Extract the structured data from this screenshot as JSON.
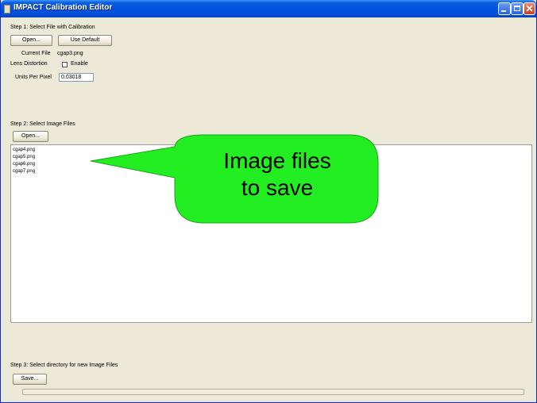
{
  "window": {
    "title": "IMPACT Calibration Editor",
    "controls": [
      "minimize-icon",
      "maximize-icon",
      "close-icon"
    ]
  },
  "step1": {
    "heading": "Step 1: Select File with Calibration",
    "open_label": "Open...",
    "use_default_label": "Use Default",
    "current_file_label": "Current File",
    "current_file_value": "cgap3.png",
    "lens_distortion_label": "Lens Distortion",
    "enable_label": "Enable",
    "enable_checked": false,
    "units_per_pixel_label": "Units Per Pixel",
    "units_per_pixel_value": "0.03018"
  },
  "step2": {
    "heading": "Step 2: Select Image Files",
    "open_label": "Open...",
    "files": [
      "cgap4.png",
      "cgap5.png",
      "cgap6.png",
      "cgap7.png"
    ]
  },
  "callout": {
    "line1": "Image files",
    "line2": "to save",
    "color": "#22ee22"
  },
  "step3": {
    "heading": "Step 3: Select directory for new Image Files",
    "save_label": "Save..."
  },
  "colors": {
    "titlebar": "#0054e3",
    "window_bg": "#ece9d8",
    "callout_fill": "#22ee22"
  }
}
